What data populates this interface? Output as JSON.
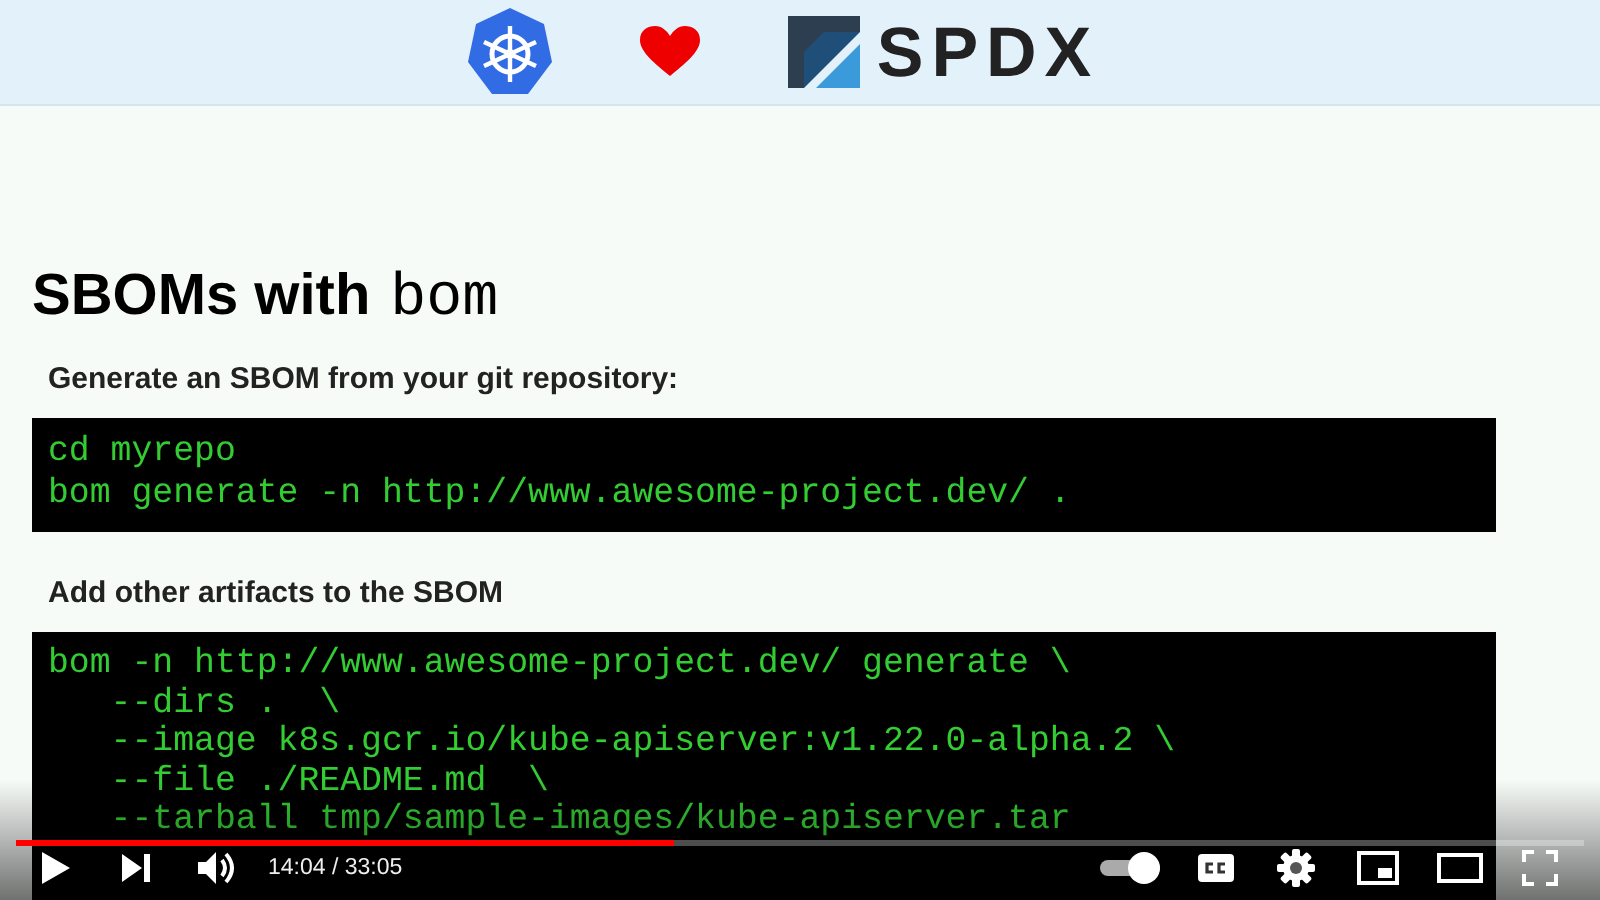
{
  "slide": {
    "logo_text": "SPDX",
    "title_bold": "SBOMs with",
    "title_code": "bom",
    "sections": [
      {
        "heading": "Generate an SBOM from your git repository:",
        "code": [
          "cd myrepo",
          "bom generate -n http://www.awesome-project.dev/ ."
        ]
      },
      {
        "heading": "Add other artifacts to the SBOM",
        "code": [
          "bom -n http://www.awesome-project.dev/ generate \\",
          "   --dirs .  \\",
          "   --image k8s.gcr.io/kube-apiserver:v1.22.0-alpha.2 \\",
          "   --file ./README.md  \\",
          "   --tarball tmp/sample-images/kube-apiserver.tar"
        ]
      }
    ]
  },
  "player": {
    "progress": {
      "level": 0.42
    },
    "autoplay": {
      "on": true
    },
    "time": "14:04 / 33:05"
  }
}
